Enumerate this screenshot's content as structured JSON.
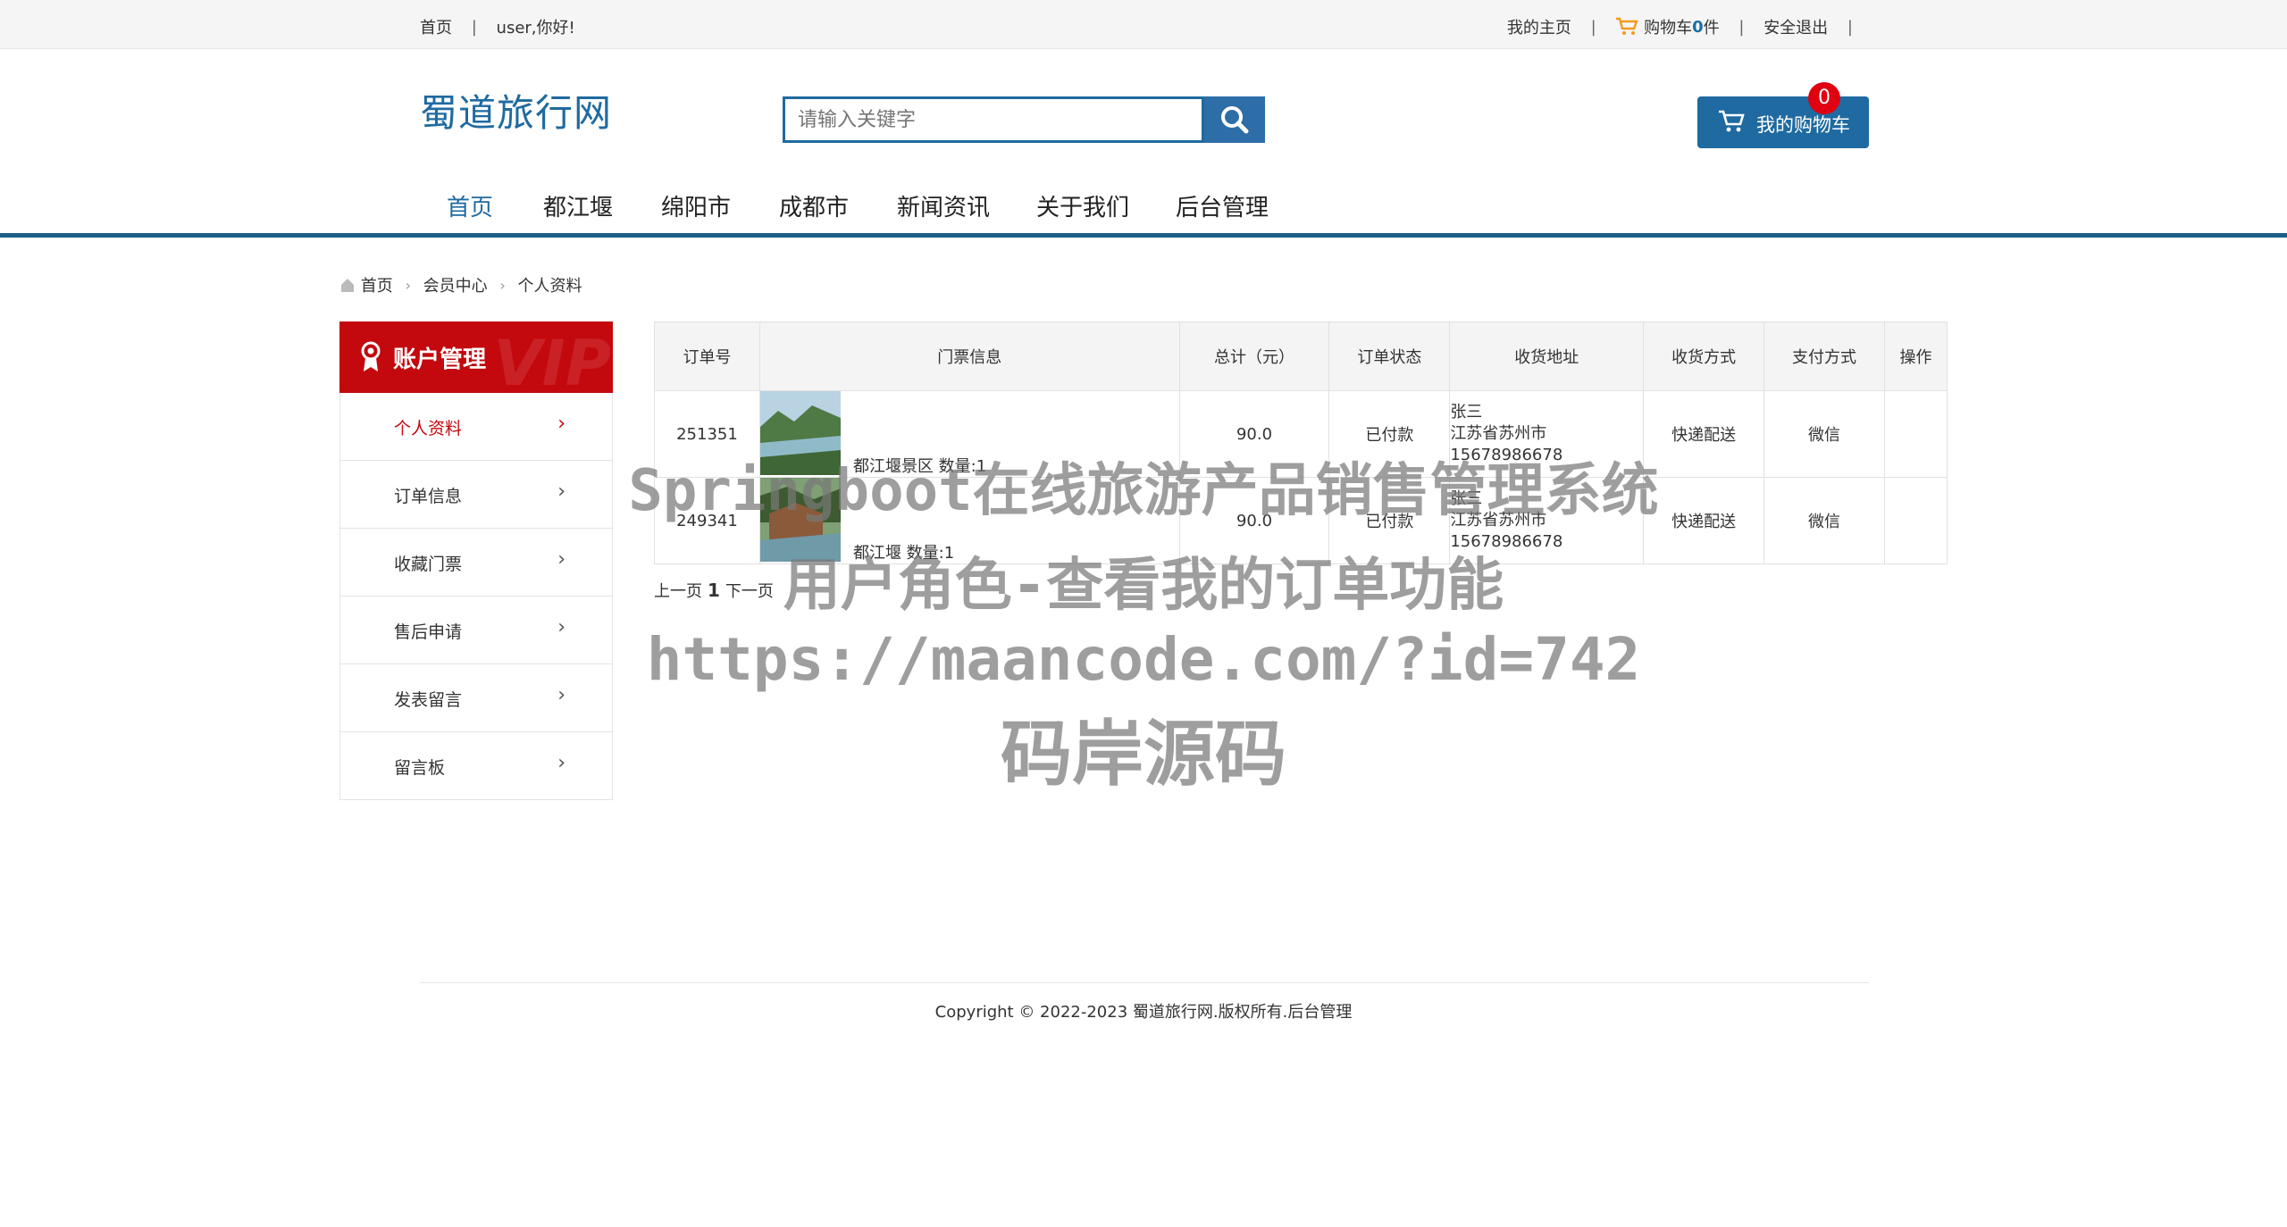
{
  "topbar": {
    "home": "首页",
    "greeting": "user,你好!",
    "my_home": "我的主页",
    "cart_prefix": "购物车",
    "cart_count": "0",
    "cart_suffix": "件",
    "logout": "安全退出"
  },
  "header": {
    "logo": "蜀道旅行网",
    "search_placeholder": "请输入关键字",
    "my_cart": "我的购物车",
    "cart_badge": "0"
  },
  "nav": {
    "items": [
      "首页",
      "都江堰",
      "绵阳市",
      "成都市",
      "新闻资讯",
      "关于我们",
      "后台管理"
    ]
  },
  "breadcrumb": [
    "首页",
    "会员中心",
    "个人资料"
  ],
  "sidebar": {
    "title": "账户管理",
    "vip": "VIP",
    "items": [
      "个人资料",
      "订单信息",
      "收藏门票",
      "售后申请",
      "发表留言",
      "留言板"
    ]
  },
  "orders": {
    "headers": [
      "订单号",
      "门票信息",
      "总计（元）",
      "订单状态",
      "收货地址",
      "收货方式",
      "支付方式",
      "操作"
    ],
    "rows": [
      {
        "id": "251351",
        "goods": "都江堰景区 数量:1",
        "total": "90.0",
        "status": "已付款",
        "name": "张三",
        "city": "江苏省苏州市",
        "phone": "15678986678",
        "delivery": "快递配送",
        "payment": "微信",
        "op": ""
      },
      {
        "id": "249341",
        "goods": "都江堰 数量:1",
        "total": "90.0",
        "status": "已付款",
        "name": "张三",
        "city": "江苏省苏州市",
        "phone": "15678986678",
        "delivery": "快递配送",
        "payment": "微信",
        "op": ""
      }
    ]
  },
  "pager": {
    "prev": "上一页",
    "current": "1",
    "next": "下一页"
  },
  "footer": {
    "text": "Copyright © 2022-2023 蜀道旅行网.版权所有.",
    "admin_link": "后台管理"
  },
  "watermark": {
    "line1": "Springboot在线旅游产品销售管理系统",
    "line2": "用户角色-查看我的订单功能",
    "line3": "https://maancode.com/?id=742",
    "line4": "码岸源码"
  },
  "colors": {
    "brand": "#1f6aa0",
    "sidebar_red": "#c3080e",
    "badge_red": "#e00012",
    "nav_line": "#1d5c86"
  }
}
